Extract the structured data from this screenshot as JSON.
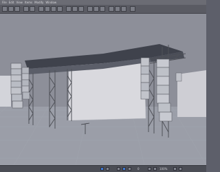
{
  "app": {
    "menu": [
      "File",
      "Edit",
      "View",
      "Items",
      "Modify",
      "Window"
    ]
  },
  "toolbar": {
    "icons": [
      "new-icon",
      "open-icon",
      "save-icon",
      "undo-icon",
      "redo-icon",
      "select-icon",
      "move-icon",
      "rotate-icon",
      "scale-icon",
      "grid-icon",
      "snap-icon",
      "align-icon",
      "camera-icon",
      "light-icon",
      "render-icon",
      "material-icon",
      "layer-icon",
      "view-icon",
      "help-icon"
    ]
  },
  "viewport": {
    "grid_color": "#9aa0a8",
    "stage_roof_color": "#4b4e58",
    "truss_color": "#5a5c63",
    "speaker_color": "#b9bcc4",
    "backdrop_color": "#d9d9de"
  },
  "statusbar": {
    "frame_label": "0",
    "zoom_label": "100%"
  }
}
